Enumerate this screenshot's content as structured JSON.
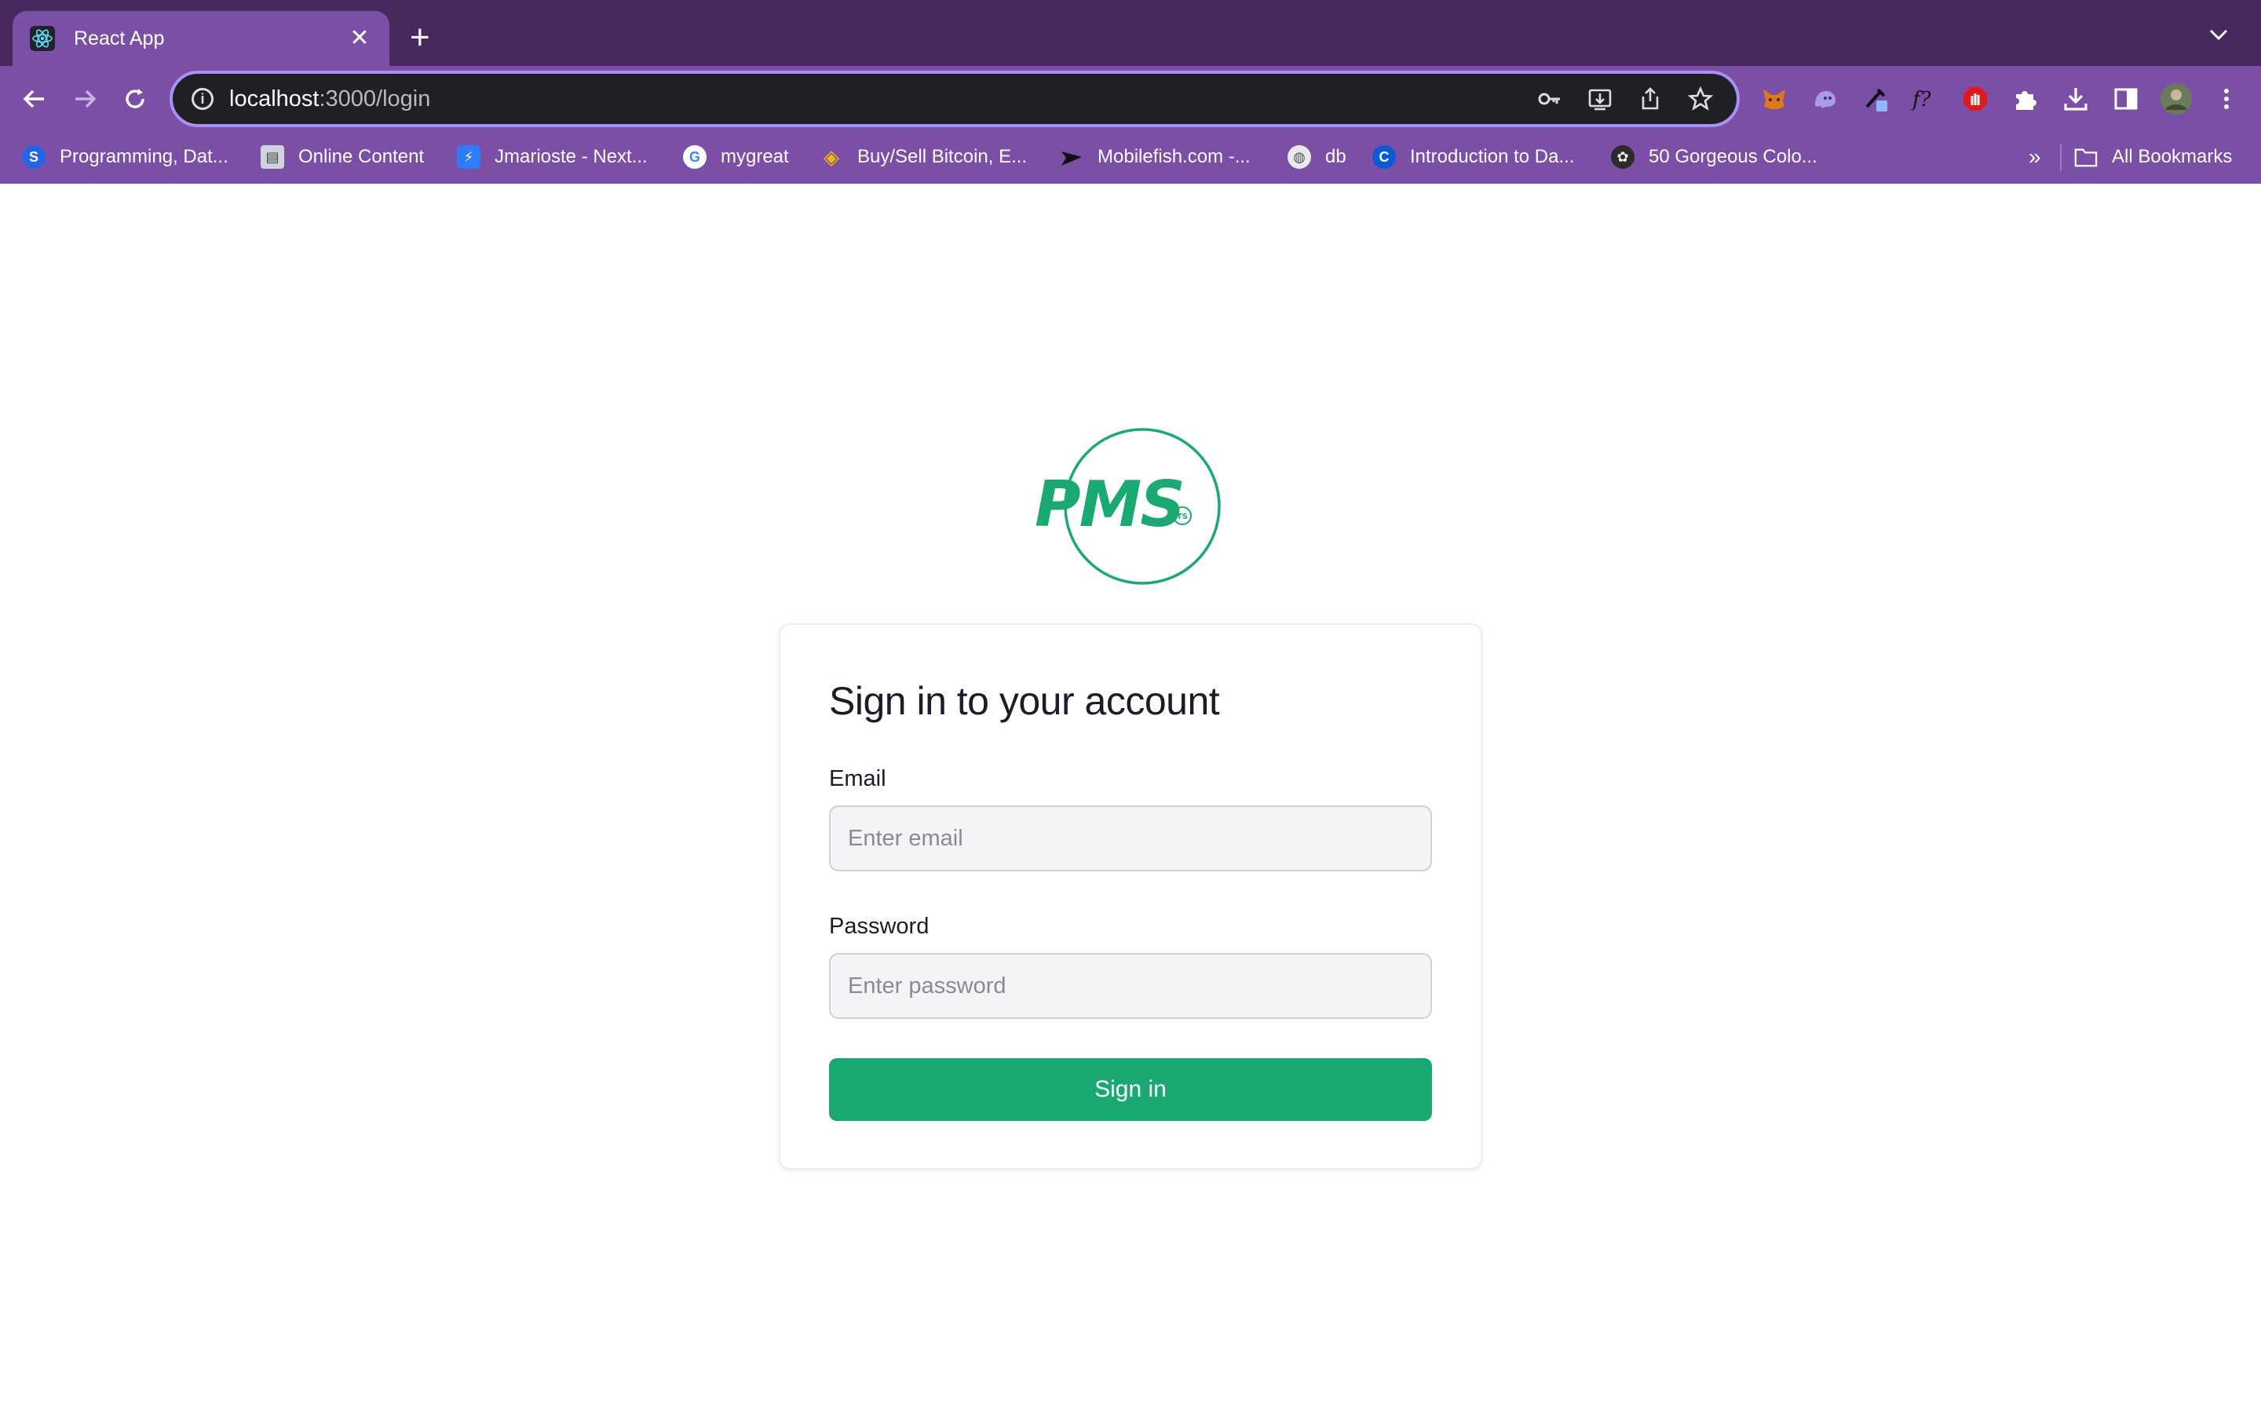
{
  "browser": {
    "tab": {
      "title": "React App",
      "favicon": "react-icon"
    },
    "address_bar": {
      "host": "localhost",
      "path": ":3000/login"
    },
    "bookmarks": [
      {
        "label": "Programming, Dat...",
        "icon": "s-icon"
      },
      {
        "label": "Online Content",
        "icon": "book-icon"
      },
      {
        "label": "Jmarioste - Next...",
        "icon": "bolt-icon"
      },
      {
        "label": "mygreat",
        "icon": "google-icon"
      },
      {
        "label": "Buy/Sell Bitcoin, E...",
        "icon": "binance-icon"
      },
      {
        "label": "Mobilefish.com -...",
        "icon": "fish-icon"
      },
      {
        "label": "db",
        "icon": "globe-icon"
      },
      {
        "label": "Introduction to Da...",
        "icon": "c-icon"
      },
      {
        "label": "50 Gorgeous Colo...",
        "icon": "palette-icon"
      }
    ],
    "more_bookmarks": "»",
    "all_bookmarks": "All Bookmarks"
  },
  "logo": {
    "text": "PMS",
    "badge": "TS"
  },
  "login": {
    "heading": "Sign in to your account",
    "email_label": "Email",
    "email_placeholder": "Enter email",
    "email_value": "",
    "password_label": "Password",
    "password_placeholder": "Enter password",
    "password_value": "",
    "submit_label": "Sign in"
  },
  "colors": {
    "tabstrip": "#47295f",
    "toolbar": "#7a4fa5",
    "brand_green": "#1aa971",
    "omnibox_border": "#a98ff7"
  }
}
